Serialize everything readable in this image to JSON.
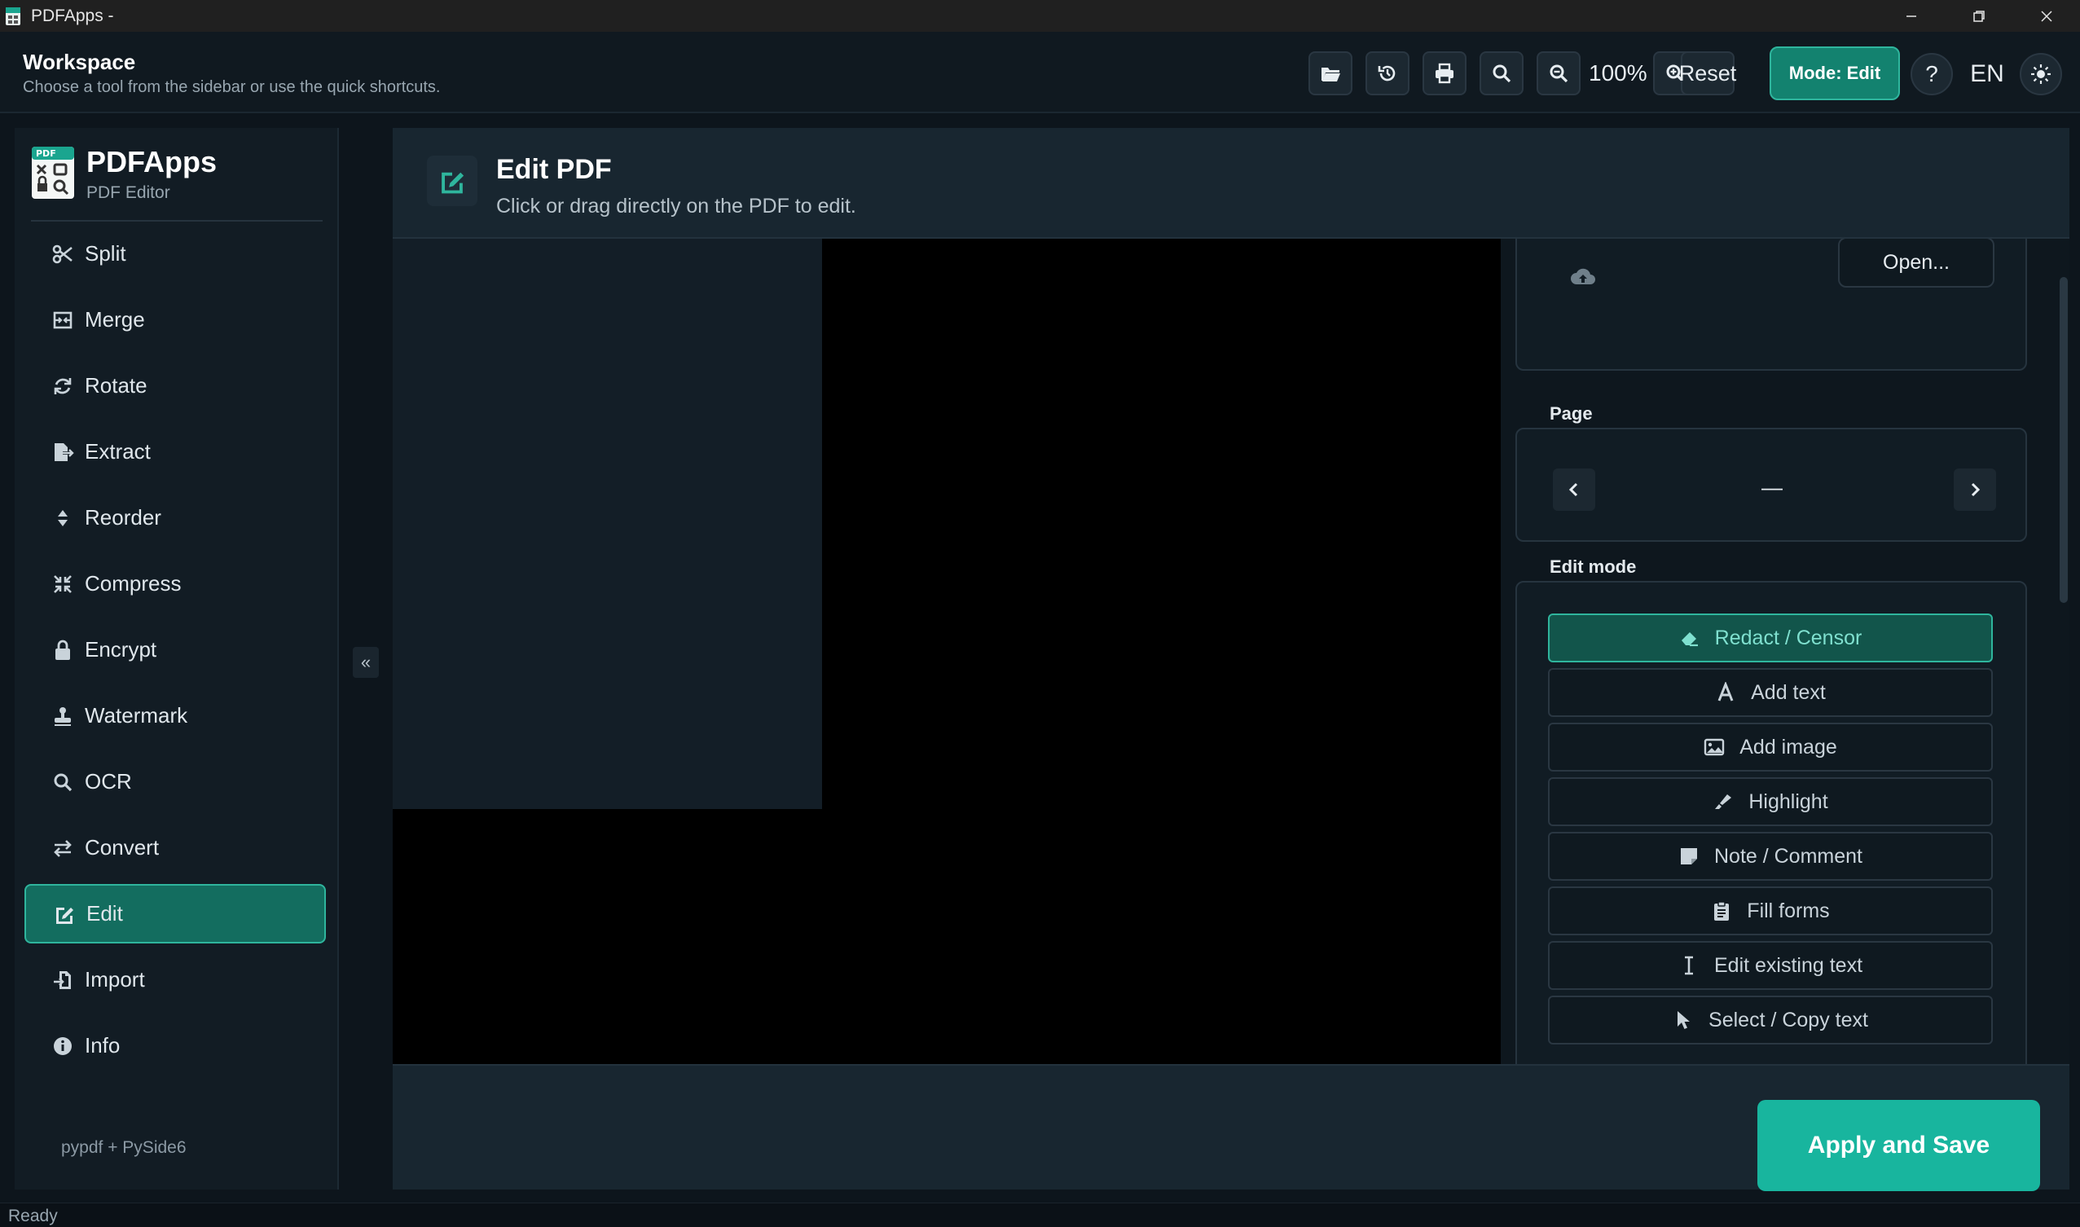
{
  "window": {
    "title": "PDFApps -"
  },
  "header": {
    "title": "Workspace",
    "subtitle": "Choose a tool from the sidebar or use the quick shortcuts.",
    "zoom": "100%",
    "reset_label": "Reset",
    "mode_label": "Mode: Edit",
    "help_label": "?",
    "language": "EN"
  },
  "brand": {
    "name": "PDFApps",
    "subtitle": "PDF Editor",
    "logo_text": "PDF"
  },
  "sidebar": {
    "items": [
      {
        "label": "Split",
        "icon": "scissors-icon"
      },
      {
        "label": "Merge",
        "icon": "merge-icon"
      },
      {
        "label": "Rotate",
        "icon": "rotate-icon"
      },
      {
        "label": "Extract",
        "icon": "extract-icon"
      },
      {
        "label": "Reorder",
        "icon": "sort-icon"
      },
      {
        "label": "Compress",
        "icon": "compress-icon"
      },
      {
        "label": "Encrypt",
        "icon": "lock-icon"
      },
      {
        "label": "Watermark",
        "icon": "stamp-icon"
      },
      {
        "label": "OCR",
        "icon": "search-icon"
      },
      {
        "label": "Convert",
        "icon": "exchange-icon"
      },
      {
        "label": "Edit",
        "icon": "edit-icon",
        "active": true
      },
      {
        "label": "Import",
        "icon": "import-icon"
      },
      {
        "label": "Info",
        "icon": "info-icon"
      }
    ],
    "footer": "pypdf  +  PySide6",
    "collapse_label": "«"
  },
  "main": {
    "title": "Edit PDF",
    "subtitle": "Click or drag directly on the PDF to edit."
  },
  "panel": {
    "open_label": "Open...",
    "page_label": "Page",
    "page_indicator": "—",
    "edit_mode_label": "Edit mode",
    "modes": [
      {
        "label": "Redact / Censor",
        "icon": "eraser-icon",
        "active": true
      },
      {
        "label": "Add text",
        "icon": "text-icon"
      },
      {
        "label": "Add image",
        "icon": "image-icon"
      },
      {
        "label": "Highlight",
        "icon": "highlighter-icon"
      },
      {
        "label": "Note / Comment",
        "icon": "note-icon"
      },
      {
        "label": "Fill forms",
        "icon": "clipboard-icon"
      },
      {
        "label": "Edit existing text",
        "icon": "text-cursor-icon"
      },
      {
        "label": "Select / Copy text",
        "icon": "pointer-icon"
      }
    ]
  },
  "footer": {
    "apply_label": "Apply and Save"
  },
  "status": {
    "text": "Ready"
  },
  "colors": {
    "accent": "#2fb59d",
    "accent_fill": "#18b59e",
    "background": "#0d151c"
  }
}
